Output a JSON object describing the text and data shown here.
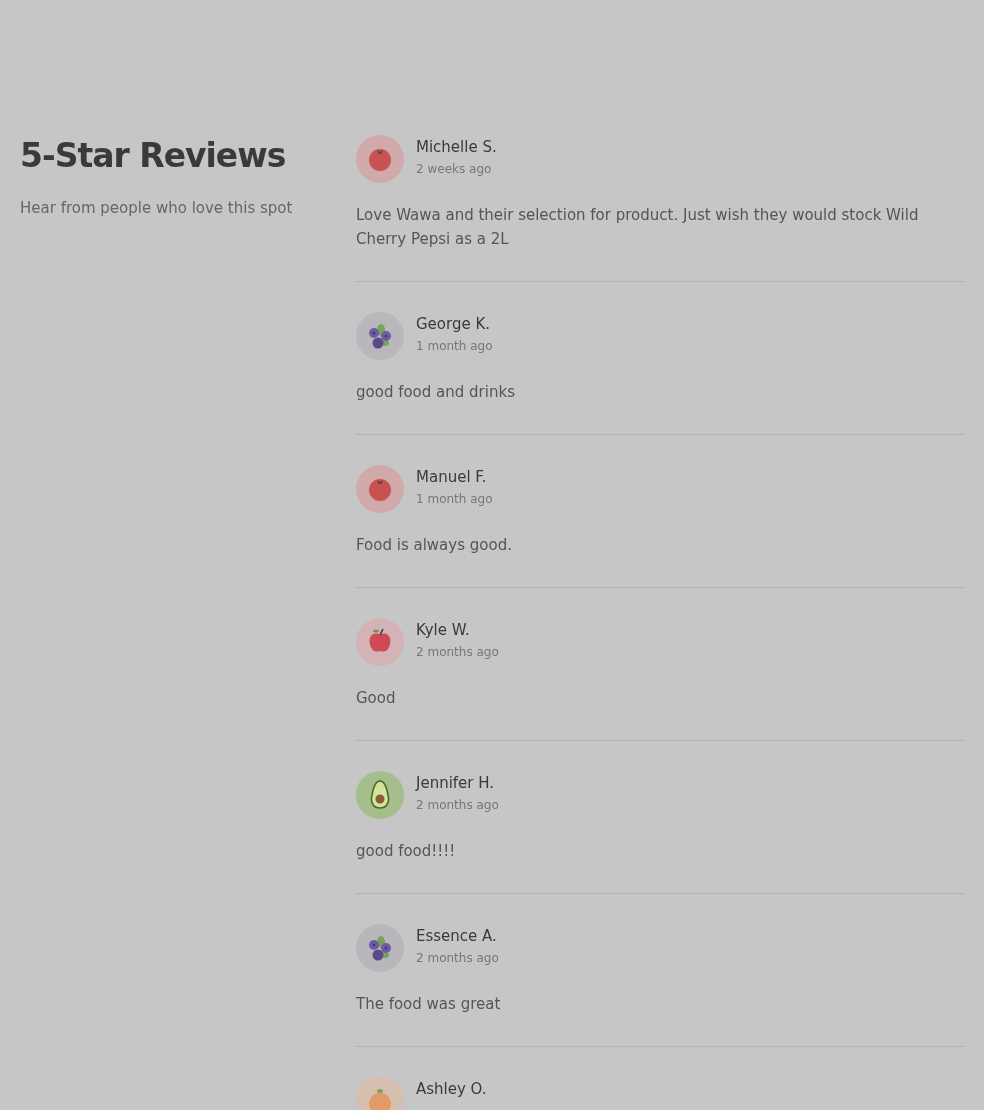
{
  "heading": {
    "title": "5-Star Reviews",
    "subtitle": "Hear from people who love this spot"
  },
  "reviews": [
    {
      "name": "Michelle S.",
      "time": "2 weeks ago",
      "text": "Love Wawa and their selection for product. Just wish they would stock Wild Cherry Pepsi as a 2L",
      "avatar": {
        "kind": "tomato"
      }
    },
    {
      "name": "George K.",
      "time": "1 month ago",
      "text": "good food and drinks",
      "avatar": {
        "kind": "blueberry"
      }
    },
    {
      "name": "Manuel F.",
      "time": "1 month ago",
      "text": "Food is always good.",
      "avatar": {
        "kind": "tomato"
      }
    },
    {
      "name": "Kyle W.",
      "time": "2 months ago",
      "text": "Good",
      "avatar": {
        "kind": "apple"
      }
    },
    {
      "name": "Jennifer H.",
      "time": "2 months ago",
      "text": "good food!!!!",
      "avatar": {
        "kind": "avocado"
      }
    },
    {
      "name": "Essence A.",
      "time": "2 months ago",
      "text": "The food was great",
      "avatar": {
        "kind": "blueberry"
      }
    },
    {
      "name": "Ashley O.",
      "avatar": {
        "kind": "peach"
      }
    }
  ]
}
